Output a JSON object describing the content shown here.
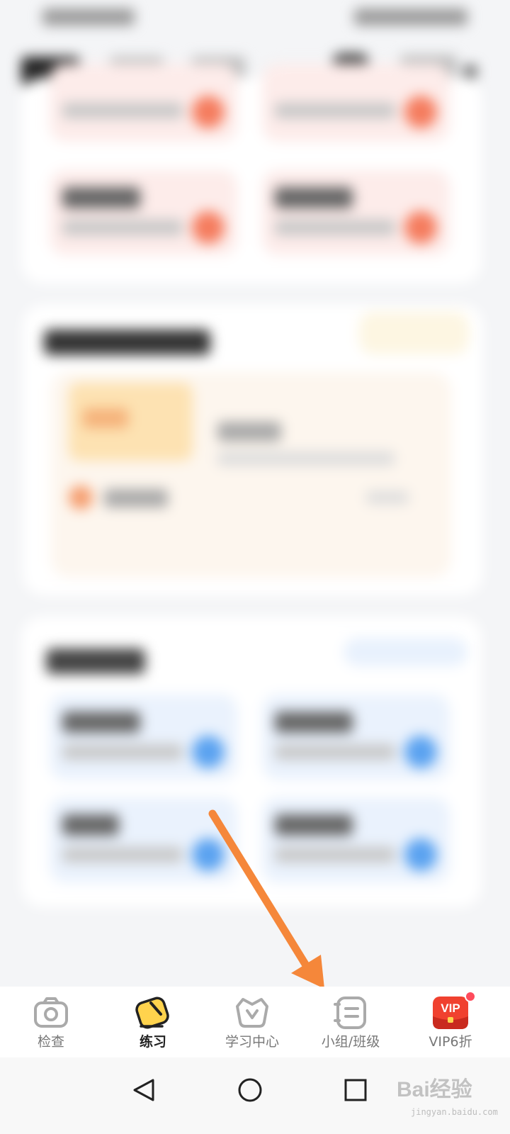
{
  "bottom_nav": {
    "items": [
      {
        "label": "检查",
        "icon": "camera-icon",
        "active": false
      },
      {
        "label": "练习",
        "icon": "pencil-icon",
        "active": true
      },
      {
        "label": "学习中心",
        "icon": "basket-icon",
        "active": false
      },
      {
        "label": "小组/班级",
        "icon": "list-icon",
        "active": false
      },
      {
        "label": "VIP6折",
        "icon": "vip-icon",
        "active": false
      }
    ],
    "vip_icon_text": "VIP"
  },
  "system_nav": {
    "buttons": [
      "back-icon",
      "home-icon",
      "recents-icon"
    ]
  },
  "watermark": {
    "brand": "Bai经验",
    "domain": "jingyan.baidu.com"
  },
  "colors": {
    "accent_orange": "#f5873a",
    "vip_red": "#f0412f",
    "active_text": "#222222",
    "inactive_text": "#777777"
  }
}
